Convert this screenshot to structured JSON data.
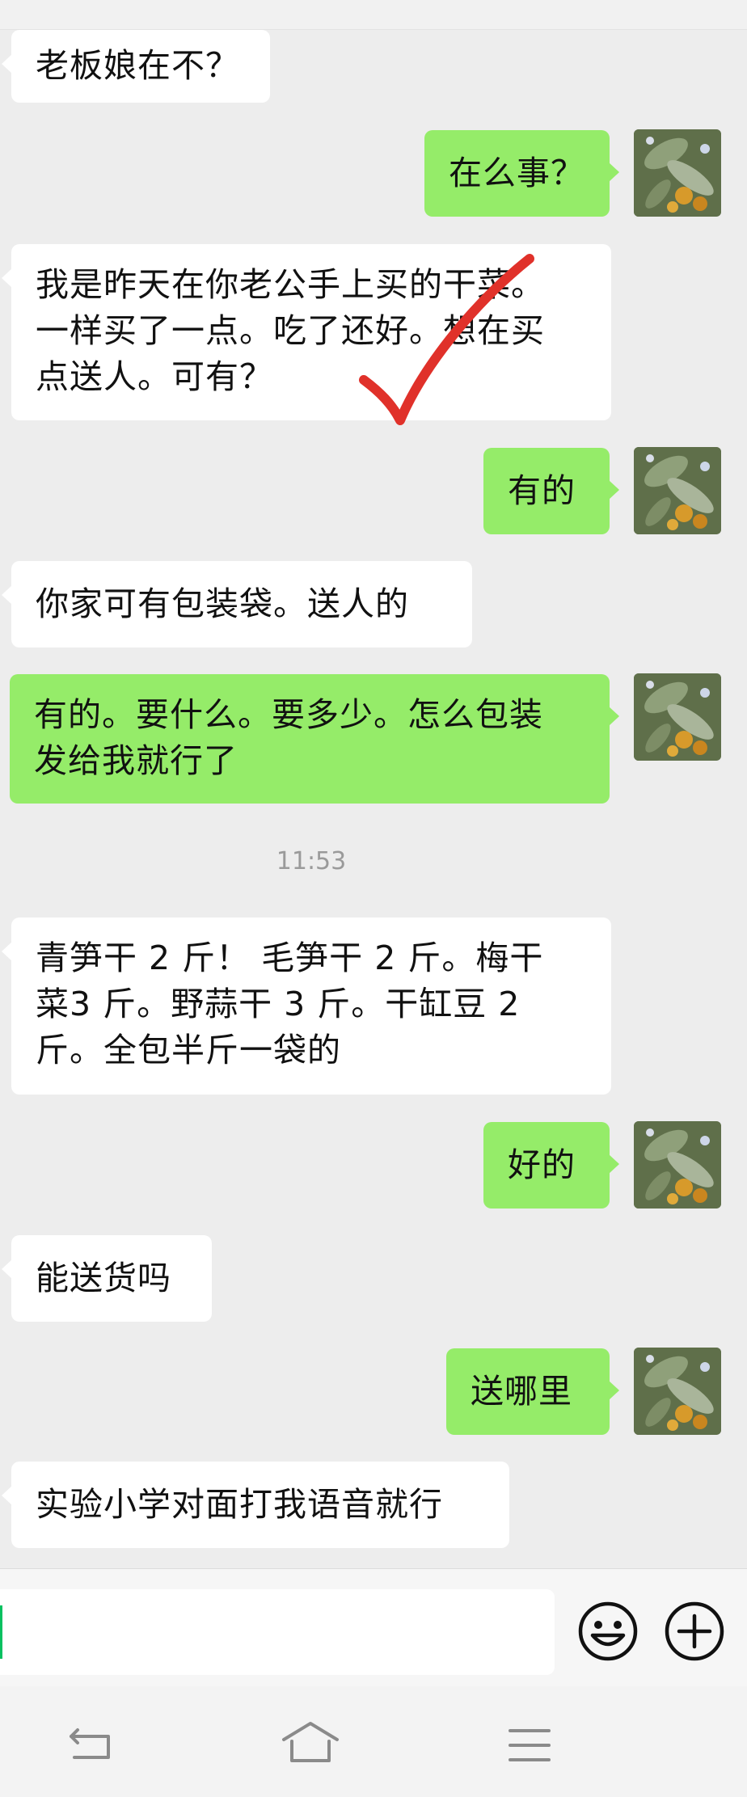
{
  "chat": {
    "messages": [
      {
        "side": "in",
        "text": "老板娘在不？"
      },
      {
        "side": "out",
        "text": "在么事？"
      },
      {
        "side": "in",
        "lines": [
          "我是昨天在你老公手上买的干菜。",
          "一样买了一点。吃了还好。想在买",
          "点送人。可有？"
        ]
      },
      {
        "side": "out",
        "text": "有的"
      },
      {
        "side": "in",
        "text": "你家可有包装袋。送人的"
      },
      {
        "side": "out",
        "lines": [
          "有的。要什么。要多少。怎么包装",
          "发给我就行了"
        ]
      },
      {
        "side": "in",
        "lines": [
          "青笋干 2 斤！ 毛笋干 2 斤。梅干",
          "菜3 斤。野蒜干 3 斤。干缸豆 2",
          "斤。全包半斤一袋的"
        ]
      },
      {
        "side": "out",
        "text": "好的"
      },
      {
        "side": "in",
        "text": "能送货吗"
      },
      {
        "side": "out",
        "text": "送哪里"
      },
      {
        "side": "in",
        "text": "实验小学对面打我语音就行"
      }
    ],
    "timestamp": "11:53"
  },
  "input": {
    "value": "",
    "emoji_icon": "smiley-face-icon",
    "more_icon": "plus-circle-icon"
  },
  "nav": {
    "back_icon": "back-arrow-icon",
    "home_icon": "home-icon",
    "menu_icon": "menu-lines-icon"
  },
  "colors": {
    "background": "#ededed",
    "incoming_bubble": "#ffffff",
    "outgoing_bubble": "#95ec69",
    "annotation_check": "#e0312a"
  }
}
